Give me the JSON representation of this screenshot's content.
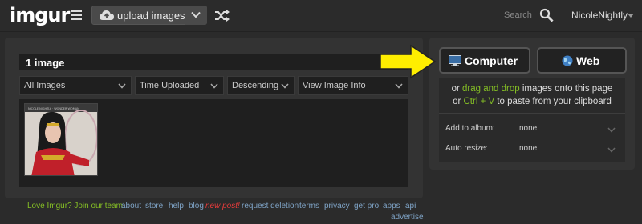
{
  "header": {
    "logo": "imgur",
    "upload_label": "upload images",
    "search_label": "Search",
    "username": "NicoleNightly"
  },
  "main": {
    "image_count": "1 image",
    "filters": [
      "All Images",
      "Time Uploaded",
      "Descending",
      "View Image Info"
    ],
    "thumbnail_caption": "NICOLE NIGHTLY · WONDER WOMAN"
  },
  "upload": {
    "computer_label": "Computer",
    "web_label": "Web",
    "line1_prefix": "or ",
    "line1_link": "drag and drop",
    "line1_suffix": " images onto this page",
    "line2_prefix": "or ",
    "line2_link": "Ctrl + V",
    "line2_suffix": " to paste from your clipboard",
    "album_label": "Add to album:",
    "album_value": "none",
    "resize_label": "Auto resize:",
    "resize_value": "none"
  },
  "footer": {
    "love": "Love Imgur? Join our team!",
    "about": "about",
    "store": "store",
    "help": "help",
    "blog": "blog",
    "new_post": "new post!",
    "request_deletion": "request deletion",
    "terms": "terms",
    "privacy": "privacy",
    "get_pro": "get pro",
    "apps": "apps",
    "api": "api",
    "advertise": "advertise"
  },
  "colors": {
    "accent_green": "#85bf25",
    "link_blue": "#7fa4c7",
    "arrow_yellow": "#ffee00"
  }
}
